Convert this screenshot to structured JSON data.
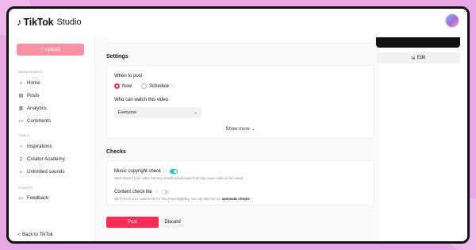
{
  "app": {
    "logo_icon": "tiktok-note-icon",
    "brand": "TikTok",
    "product": "Studio"
  },
  "sidebar": {
    "upload_label": "Upload",
    "sections": {
      "management": "MANAGEMENT",
      "tools": "TOOLS",
      "others": "OTHERS"
    },
    "items": [
      {
        "label": "Home",
        "icon": "home-icon"
      },
      {
        "label": "Posts",
        "icon": "posts-icon"
      },
      {
        "label": "Analytics",
        "icon": "analytics-icon"
      },
      {
        "label": "Comments",
        "icon": "comments-icon"
      },
      {
        "label": "Inspirations",
        "icon": "lightbulb-icon"
      },
      {
        "label": "Creator Academy",
        "icon": "academy-icon"
      },
      {
        "label": "Unlimited sounds",
        "icon": "music-note-icon"
      },
      {
        "label": "Feedback",
        "icon": "feedback-icon"
      }
    ],
    "back_label": "Back to TikTok"
  },
  "settings": {
    "heading": "Settings",
    "when_to_post": "When to post",
    "option_now": "Now",
    "option_schedule": "Schedule",
    "who_can_watch": "Who can watch this video",
    "audience_value": "Everyone",
    "show_more": "Show more"
  },
  "checks": {
    "heading": "Checks",
    "music_title": "Music copyright check",
    "music_desc": "We'll check if your video has any unauthorized music that may cause video to be muted.",
    "music_enabled": true,
    "content_title": "Content check lite",
    "content_desc": "We'll check your content for For You Feed eligibility. You can also turn on",
    "content_link": "automatic checks",
    "content_enabled": false
  },
  "actions": {
    "post": "Post",
    "discard": "Discard"
  },
  "preview": {
    "edit": "Edit"
  },
  "colors": {
    "accent": "#fe2c55",
    "toggle_on": "#20c5d0",
    "background": "#e9a6e6"
  }
}
